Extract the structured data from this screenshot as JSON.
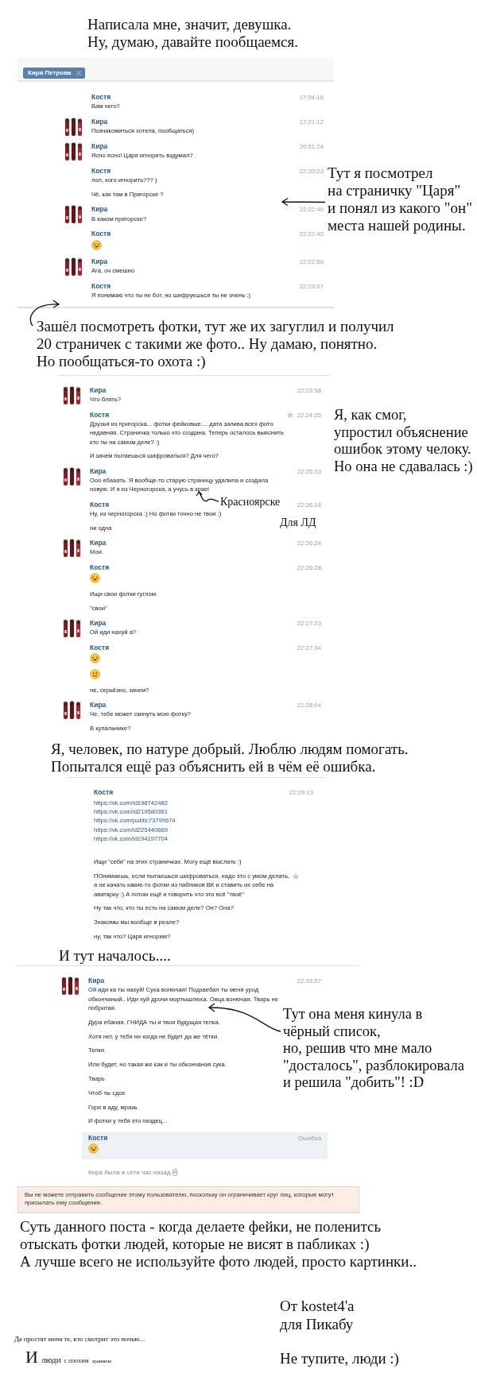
{
  "blocks": [
    {
      "kind": "caption",
      "lines": [
        "Написала мне, значит, девушка.",
        "Ну, думаю, давайте пообщаемся."
      ]
    },
    {
      "kind": "chat",
      "tab": "Кира Петрова",
      "messages": [
        {
          "author": "Костя",
          "time": "17:04:16",
          "avatar": false,
          "starred": false,
          "error": false,
          "paragraphs": [
            {
              "kind": "text",
              "lines": [
                "Вам чего?"
              ]
            }
          ]
        },
        {
          "author": "Кира",
          "time": "17:21:12",
          "avatar": true,
          "starred": false,
          "error": false,
          "paragraphs": [
            {
              "kind": "text",
              "lines": [
                "Познакомиться хотела, пообщаться)"
              ]
            }
          ]
        },
        {
          "author": "Кира",
          "time": "20:51:24",
          "avatar": true,
          "starred": false,
          "error": false,
          "paragraphs": [
            {
              "kind": "text",
              "lines": [
                "Ясно ясно! Царя игнорить вздумал?"
              ]
            }
          ]
        },
        {
          "author": "Костя",
          "time": "22:20:23",
          "avatar": false,
          "starred": false,
          "error": false,
          "paragraphs": [
            {
              "kind": "text",
              "lines": [
                "лол, кого игнорить??? )"
              ]
            },
            {
              "kind": "text",
              "lines": [
                "Чё, как там в Пригорске ?"
              ]
            }
          ]
        },
        {
          "author": "Кира",
          "time": "22:22:40",
          "avatar": true,
          "starred": false,
          "error": false,
          "paragraphs": [
            {
              "kind": "text",
              "lines": [
                "В каком пригорске?"
              ]
            }
          ]
        },
        {
          "author": "Костя",
          "time": "22:22:45",
          "avatar": false,
          "starred": false,
          "error": false,
          "paragraphs": [
            {
              "kind": "laugh"
            }
          ]
        },
        {
          "author": "Кира",
          "time": "22:22:56",
          "avatar": true,
          "starred": false,
          "error": false,
          "paragraphs": [
            {
              "kind": "text",
              "lines": [
                "Ага, оч смешно"
              ]
            }
          ]
        },
        {
          "author": "Костя",
          "time": "22:23:07",
          "avatar": false,
          "starred": false,
          "error": false,
          "paragraphs": [
            {
              "kind": "text",
              "lines": [
                "Я понимаю что ты не бот, но шифруешься ты не очень :)"
              ]
            }
          ]
        }
      ]
    },
    {
      "kind": "caption",
      "lines": [
        "Зашёл посмотреть фотки, тут же их загуглил и получил",
        "20 страничек с такими же фото.. Ну дамаю, понятно.",
        "Но пообщаться-то охота :)"
      ]
    },
    {
      "kind": "chat",
      "messages": [
        {
          "author": "Кира",
          "time": "22:23:58",
          "avatar": true,
          "starred": false,
          "error": false,
          "paragraphs": [
            {
              "kind": "text",
              "lines": [
                "Что блять?"
              ]
            }
          ]
        },
        {
          "author": "Костя",
          "time": "22:24:35",
          "avatar": false,
          "starred": true,
          "error": false,
          "paragraphs": [
            {
              "kind": "text",
              "lines": [
                "Друзья из пригорска... фотки фейковые.... дата залива всех фото",
                "недавняя. Страничка только что создана. Теперь осталось выяснить",
                "кто ты на самом деле? :)"
              ]
            },
            {
              "kind": "text",
              "lines": [
                "И зачем пытаешься шифроваться? Для чего?"
              ]
            }
          ]
        },
        {
          "author": "Кира",
          "time": "22:25:53",
          "avatar": true,
          "starred": false,
          "error": false,
          "paragraphs": [
            {
              "kind": "text",
              "lines": [
                "Ооо ебааать. Я вообще-то старую страницу удалила и создала",
                "новую. И я из Черногорска, а учусь в крае!"
              ]
            }
          ]
        },
        {
          "author": "Костя",
          "time": "22:26:14",
          "avatar": false,
          "starred": false,
          "error": false,
          "paragraphs": [
            {
              "kind": "text",
              "lines": [
                "Ну, из черногорска :) Но фотки точно не твои :)"
              ]
            },
            {
              "kind": "text",
              "lines": [
                "ни одна"
              ]
            }
          ]
        },
        {
          "author": "Кира",
          "time": "22:26:24",
          "avatar": true,
          "starred": false,
          "error": false,
          "paragraphs": [
            {
              "kind": "text",
              "lines": [
                "Мои."
              ]
            }
          ]
        },
        {
          "author": "Костя",
          "time": "22:26:28",
          "avatar": false,
          "starred": false,
          "error": false,
          "paragraphs": [
            {
              "kind": "laugh"
            },
            {
              "kind": "text",
              "lines": [
                "Ищи свои фотки гуглом."
              ]
            },
            {
              "kind": "text",
              "lines": [
                "\"свои\""
              ]
            }
          ]
        },
        {
          "author": "Кира",
          "time": "22:27:23",
          "avatar": true,
          "starred": false,
          "error": false,
          "paragraphs": [
            {
              "kind": "text",
              "lines": [
                "Ой иди нахуй а?"
              ]
            }
          ]
        },
        {
          "author": "Костя",
          "time": "22:27:34",
          "avatar": false,
          "starred": false,
          "error": false,
          "paragraphs": [
            {
              "kind": "laugh"
            },
            {
              "kind": "smile"
            },
            {
              "kind": "text",
              "lines": [
                "не, серьёзно, зачем?"
              ]
            }
          ]
        },
        {
          "author": "Кира",
          "time": "22:28:04",
          "avatar": true,
          "starred": false,
          "error": false,
          "paragraphs": [
            {
              "kind": "text",
              "lines": [
                "Че, тебе может скинуть мою фотку?"
              ]
            },
            {
              "kind": "text",
              "lines": [
                "В купальнике?"
              ]
            }
          ]
        }
      ]
    },
    {
      "kind": "caption",
      "lines": [
        "Я, человек, по натуре добрый. Люблю людям помогать.",
        " Попытался ещё раз объяснить ей в чём её ошибка."
      ]
    },
    {
      "kind": "chat",
      "messages": [
        {
          "author": "Костя",
          "time": "22:29:13",
          "avatar": false,
          "starred": false,
          "error": false,
          "paragraphs": [
            {
              "kind": "link",
              "text": "https://vk.com/id198742482"
            },
            {
              "kind": "link",
              "text": "https://vk.com/id219580361"
            },
            {
              "kind": "link",
              "text": "https://vk.com/public73799674"
            },
            {
              "kind": "link",
              "text": "https://vk.com/id225440669"
            },
            {
              "kind": "link",
              "text": "https://vk.com/id194197704"
            },
            {
              "kind": "text",
              "lines": [
                "Ищи \"себя\" на этих страничках. Могу ещё выслать :)"
              ]
            },
            {
              "kind": "text",
              "starred": true,
              "lines": [
                "ПОнимаешь, если пытаешься шифроваться, надо это с умом делать,",
                "а не качать какие-то фотки из пабликов ВК и ставить их себе на",
                "аватарку :) А потом ещё и говорить что это всё \"твоё\""
              ]
            },
            {
              "kind": "text",
              "lines": [
                "Ну так что, кто ты есть на самом деле? Он? Она?"
              ]
            },
            {
              "kind": "text",
              "lines": [
                "Знакомы мы вообще в реале?"
              ]
            },
            {
              "kind": "text",
              "lines": [
                "ну, так что? Царя игнорим?"
              ]
            }
          ]
        }
      ]
    },
    {
      "kind": "caption",
      "lines": [
        "И тут началось...."
      ]
    },
    {
      "kind": "chat",
      "status": "Кира была в сети час назад",
      "messages": [
        {
          "author": "Кира",
          "time": "22:33:57",
          "avatar": true,
          "starred": false,
          "error": false,
          "paragraphs": [
            {
              "kind": "text",
              "lines": [
                "Ой иди ка ты нахуй! Сука вонючая! Подзаебал ты меня урод",
                "обкончаный.. Иди хуй дрочи мортышлюха. Овца вонючая. Тварь не",
                "побритая."
              ]
            },
            {
              "kind": "text",
              "lines": [
                "Дура ебаная. ГНИДА ты и твоя будущая телка."
              ]
            },
            {
              "kind": "text",
              "lines": [
                "Хотя нет, у тебя ни когда не будет да же тётки."
              ]
            },
            {
              "kind": "text",
              "lines": [
                "Телки"
              ]
            },
            {
              "kind": "text",
              "lines": [
                "Или будет, но такая же как и ты обкончаная сука."
              ]
            },
            {
              "kind": "text",
              "lines": [
                "Тварь"
              ]
            },
            {
              "kind": "text",
              "lines": [
                "Чтоб ты сдох"
              ]
            },
            {
              "kind": "text",
              "lines": [
                "Гори в аду, мразь"
              ]
            },
            {
              "kind": "text",
              "lines": [
                "И фотки у тебя это пиздец..."
              ]
            }
          ]
        },
        {
          "author": "Костя",
          "time": "Ошибка",
          "avatar": false,
          "starred": false,
          "error": true,
          "paragraphs": [
            {
              "kind": "laugh"
            }
          ]
        }
      ]
    },
    {
      "kind": "notice",
      "text": "Вы не можете отправить сообщение этому пользователю, поскольку он ограничивает круг лиц, которые могут присылать ему сообщения."
    },
    {
      "kind": "caption",
      "lines": [
        "Суть данного поста - когда делаете фейки, не поленитсь",
        "отыскать фотки людей, которые не висят в пабликах :)",
        "А лучше всего не используйте фото людей, просто картинки.."
      ]
    }
  ],
  "notes": [
    {
      "lines": [
        "Тут я посмотрел",
        "на страничку \"Царя\"",
        "и понял из какого \"он\"",
        "места нашей родины."
      ]
    },
    {
      "lines": [
        "Я, как смог,",
        "упростил объяснение",
        "ошибок этому челоку.",
        "Но она не сдавалась :)"
      ]
    },
    {
      "lines": [
        "Красноярске"
      ]
    },
    {
      "lines": [
        "Для ЛД"
      ]
    },
    {
      "lines": [
        "Тут она меня кинула в",
        "чёрный список,",
        "но, решив что мне мало",
        "\"досталось\", разблокировала",
        "и решила \"добить\"! :D"
      ]
    }
  ],
  "footer": {
    "apology": "Да простят меня те, кто смотрит это ночью...",
    "tagline": [
      "И",
      "люди",
      "с плохим",
      "зрением"
    ],
    "signature": [
      "От kostet4'a",
      "для Пикабу"
    ],
    "closing": "Не тупите, люди :)"
  }
}
